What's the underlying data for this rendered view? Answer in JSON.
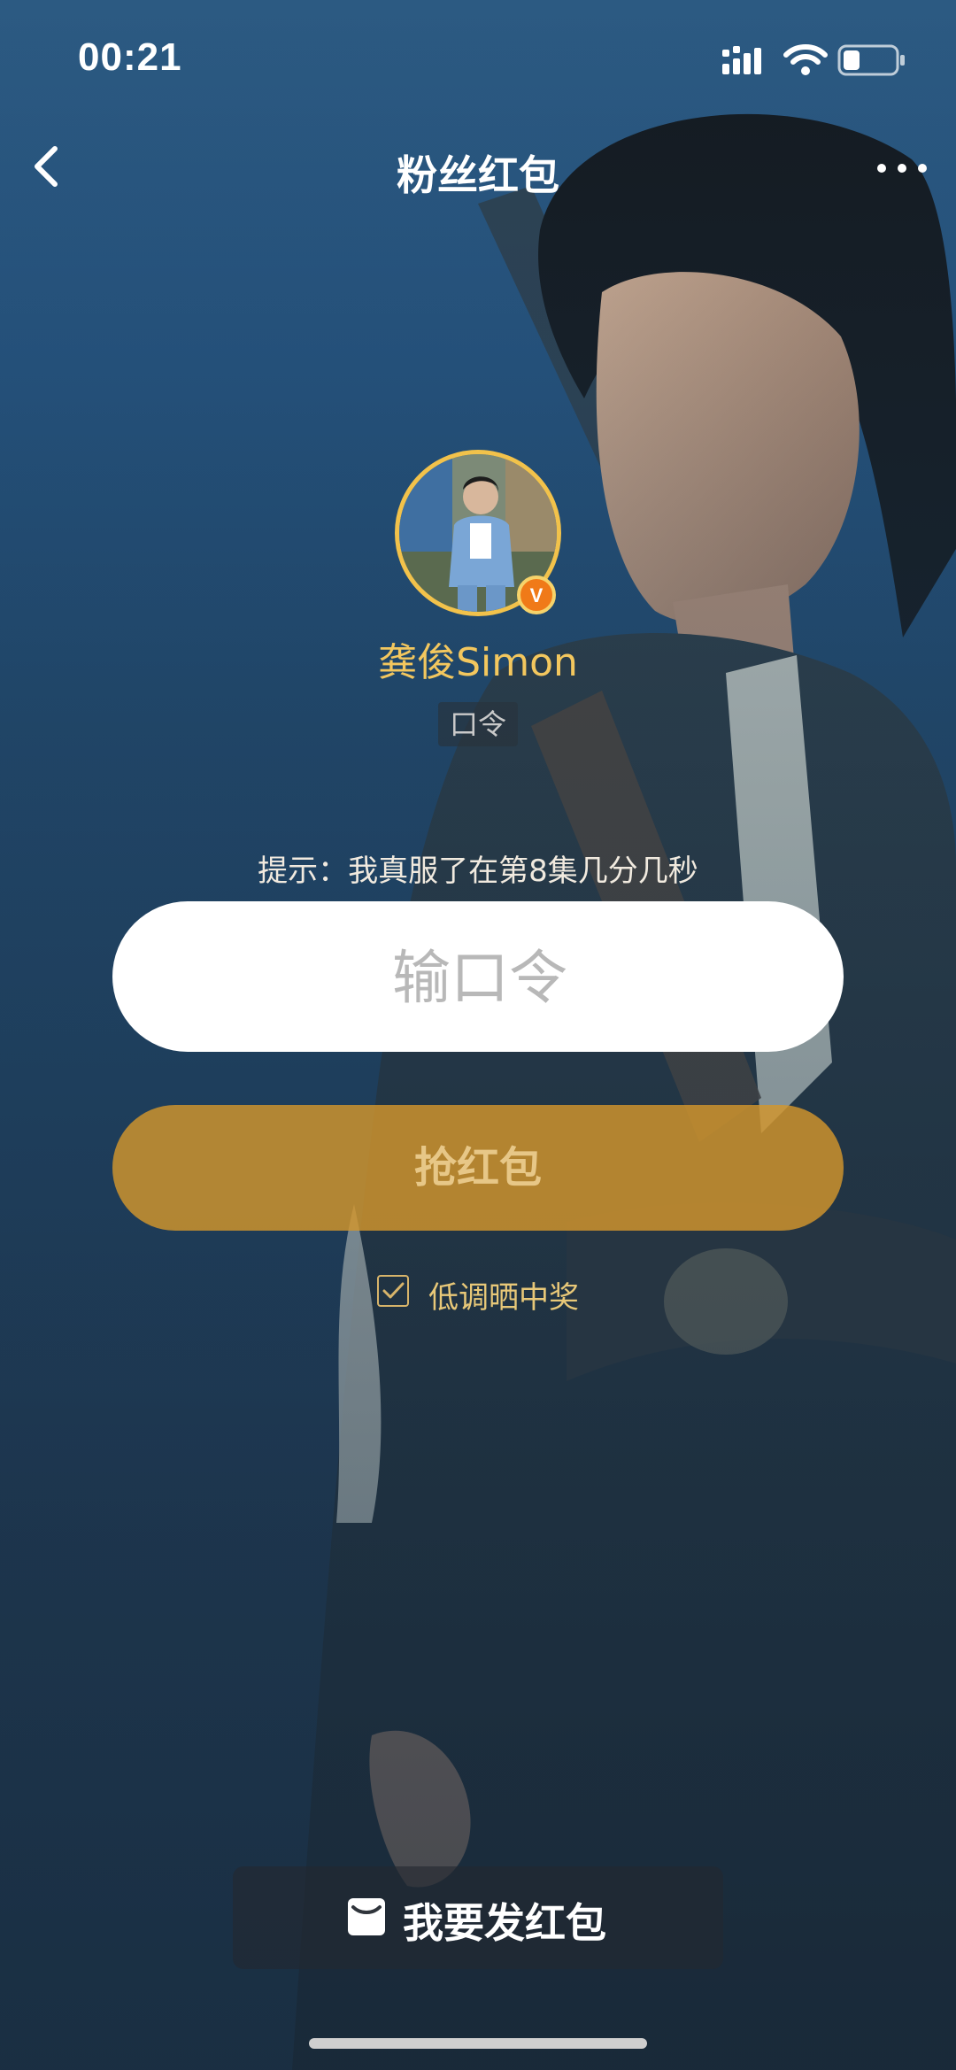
{
  "status_bar": {
    "time": "00:21",
    "icons": [
      "signal-icon",
      "wifi-icon",
      "battery-icon"
    ]
  },
  "nav": {
    "title": "粉丝红包",
    "back_icon": "chevron-left-icon",
    "more_icon": "more-horizontal-icon"
  },
  "profile": {
    "name": "龚俊Simon",
    "verified_badge": "V",
    "tag": "口令"
  },
  "hint": "提示：我真服了在第8集几分几秒",
  "password_input": {
    "placeholder": "输口令",
    "value": ""
  },
  "grab_button": {
    "label": "抢红包"
  },
  "low_key_option": {
    "label": "低调晒中奖",
    "checked": true
  },
  "send_button": {
    "label": "我要发红包",
    "icon": "red-packet-icon"
  },
  "colors": {
    "accent_gold": "#f3c75e",
    "button_orange": "#d3962c",
    "badge_orange": "#f07a18"
  }
}
